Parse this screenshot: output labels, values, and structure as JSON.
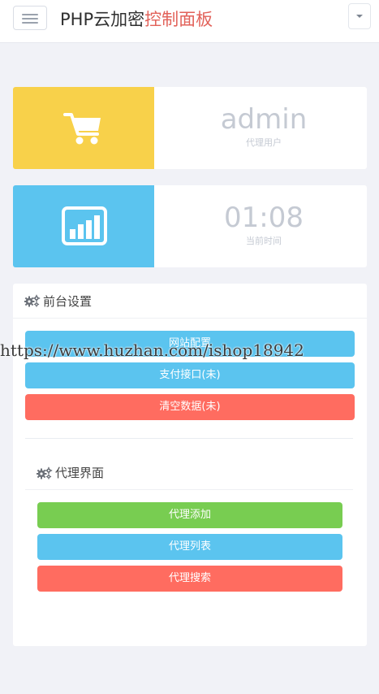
{
  "header": {
    "title_main": "PHP云加密",
    "title_accent": "控制面板",
    "menu_icon": "hamburger-icon",
    "dropdown_icon": "chevron-down-icon"
  },
  "stats": [
    {
      "value": "admin",
      "label": "代理用户",
      "icon": "cart-icon",
      "color": "#f8d14a"
    },
    {
      "value": "01:08",
      "label": "当前时间",
      "icon": "bar-chart-icon",
      "color": "#5bc4ef"
    }
  ],
  "front_settings": {
    "title": "前台设置",
    "icon": "gear-icon",
    "buttons": [
      {
        "label": "网站配置",
        "color": "#5bc4ef"
      },
      {
        "label": "支付接口(未)",
        "color": "#5bc4ef"
      },
      {
        "label": "清空数据(未)",
        "color": "#ff6c60"
      }
    ]
  },
  "agent_panel": {
    "title": "代理界面",
    "icon": "gear-icon",
    "buttons": [
      {
        "label": "代理添加",
        "color": "#78cd51"
      },
      {
        "label": "代理列表",
        "color": "#5bc4ef"
      },
      {
        "label": "代理搜索",
        "color": "#ff6c60"
      }
    ]
  },
  "watermark": "https://www.huzhan.com/ishop18942"
}
